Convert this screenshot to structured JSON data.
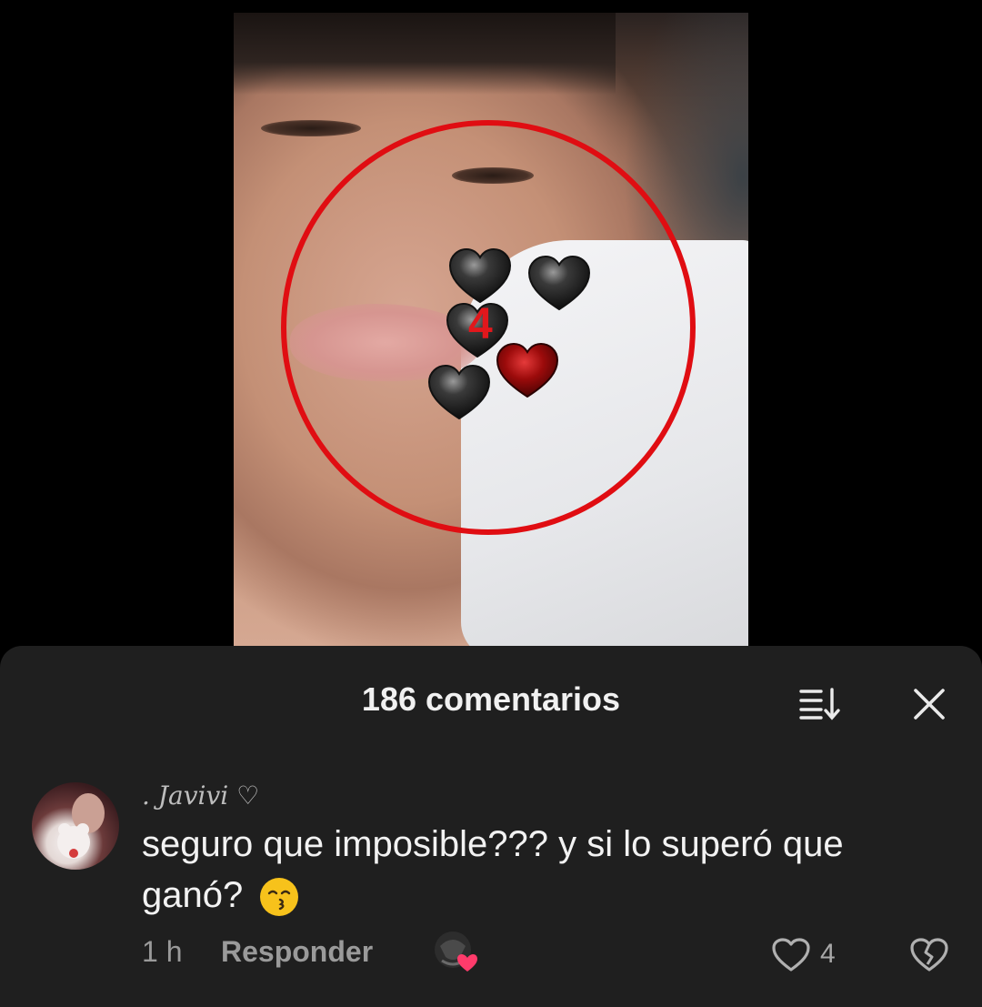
{
  "video": {
    "counter": "4"
  },
  "comments_sheet": {
    "title": "186 comentarios",
    "sort_icon": "sort-descending-icon",
    "close_icon": "close-icon"
  },
  "comment": {
    "username": ". Javivi ♡",
    "text": "seguro que imposible??? y si lo superó que ganó?",
    "emoji": "kissing-face-emoji",
    "time": "1 h",
    "reply_label": "Responder",
    "like_count": "4",
    "like_icon": "heart-outline-icon",
    "dislike_icon": "broken-heart-icon"
  }
}
